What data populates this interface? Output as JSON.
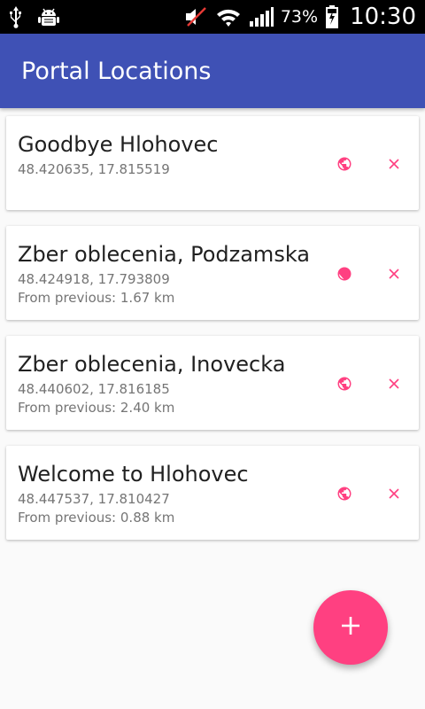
{
  "status_bar": {
    "battery_percent": "73%",
    "time": "10:30",
    "icons": [
      "usb-icon",
      "android-debug-icon",
      "mute-icon",
      "wifi-icon",
      "signal-icon",
      "battery-charging-icon"
    ]
  },
  "app_bar": {
    "title": "Portal Locations",
    "color": "#3f51b5"
  },
  "locations": [
    {
      "name": "Goodbye Hlohovec",
      "coords": "48.420635, 17.815519",
      "distance": ""
    },
    {
      "name": "Zber oblecenia, Podzamska",
      "coords": "48.424918, 17.793809",
      "distance": "From previous: 1.67 km"
    },
    {
      "name": "Zber oblecenia, Inovecka",
      "coords": "48.440602, 17.816185",
      "distance": "From previous: 2.40 km"
    },
    {
      "name": "Welcome to Hlohovec",
      "coords": "48.447537, 17.810427",
      "distance": "From previous: 0.88 km"
    }
  ],
  "actions": {
    "map_icon": "globe-icon",
    "delete_icon": "close-icon",
    "accent_color": "#ff4081"
  },
  "fab": {
    "icon": "plus-icon",
    "color": "#ff4081"
  }
}
